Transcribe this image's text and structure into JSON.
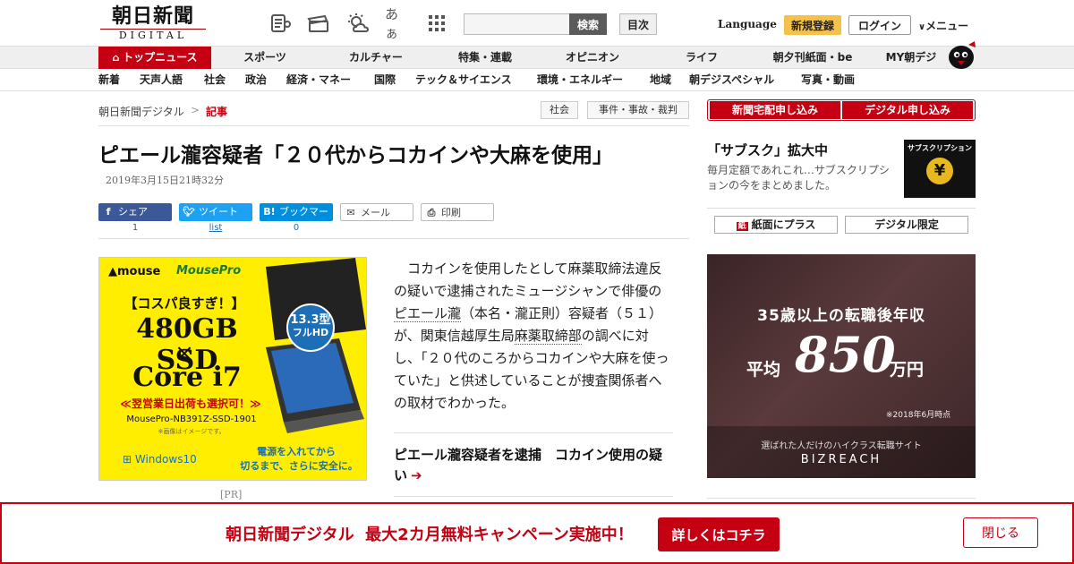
{
  "header": {
    "logo_main": "朝日新聞",
    "logo_sub": "DIGITAL",
    "icons": [
      "newspaper-icon",
      "ticket-icon",
      "weather-icon",
      "font-size-icon",
      "grid-icon"
    ],
    "font_size_glyph": "あぁ",
    "search_placeholder": "",
    "search_label": "検索",
    "index_label": "目次",
    "language_label": "Language",
    "register_label": "新規登録",
    "login_label": "ログイン",
    "menu_label": "メニュー"
  },
  "nav_primary": [
    "トップニュース",
    "スポーツ",
    "カルチャー",
    "特集・連載",
    "オピニオン",
    "ライフ",
    "朝夕刊紙面・be",
    "MY朝デジ"
  ],
  "nav_secondary": [
    "新着",
    "天声人語",
    "社会",
    "政治",
    "経済・マネー",
    "国際",
    "テック＆サイエンス",
    "環境・エネルギー",
    "地域",
    "朝デジスペシャル",
    "写真・動画"
  ],
  "breadcrumb": [
    "朝日新聞デジタル",
    "記事"
  ],
  "breadcrumb_sep": ">",
  "tags": [
    "社会",
    "事件・事故・裁判"
  ],
  "article": {
    "title": "ピエール瀧容疑者「２０代からコカインや大麻を使用」",
    "date": "2019年3月15日21時32分",
    "share": [
      {
        "label": "シェア",
        "count": "1",
        "color": "#3b5998",
        "icon": "f"
      },
      {
        "label": "ツイート",
        "count": "list",
        "color": "#1da1f2",
        "icon": "t"
      },
      {
        "label": "ブックマーク",
        "count": "0",
        "color": "#008fde",
        "icon": "B!"
      },
      {
        "label": "メール",
        "count": "",
        "color": "#ffffff",
        "icon": "✉"
      },
      {
        "label": "印刷",
        "count": "",
        "color": "#ffffff",
        "icon": "⎙"
      }
    ],
    "body_1": "　コカインを使用したとして麻薬取締法違反の疑いで逮捕されたミュージシャンで俳優の",
    "body_link1": "ピエール瀧",
    "body_2": "（本名・瀧正則）容疑者（５１）が、関東信越厚生局",
    "body_link2": "麻薬取締部",
    "body_3": "の調べに対し、「２０代のころからコカインや大麻を使っていた」と供述していることが捜査関係者への取材でわかった。",
    "related_title": "ピエール瀧容疑者を逮捕　コカイン使用の疑い",
    "related_arrow": "➔"
  },
  "ad_left": {
    "brand": "mouse",
    "brand2": "MousePro",
    "tagline": "【コスパ良すぎ！】",
    "spec1": "480GB SSD",
    "times": "×",
    "spec2": "Core i7",
    "tm": "TM",
    "campaign": "≪翌営業日出荷も選択可！≫",
    "model": "MousePro-NB391Z-SSD-1901",
    "note": "※画像はイメージです。",
    "screen_size": "13.3型",
    "screen_res": "フルHD",
    "os": "Windows10",
    "copy1": "電源を入れてから",
    "copy2": "切るまで、さらに安全に。",
    "pr_label": "[PR]"
  },
  "sidebar": {
    "sub_buttons": [
      "新聞宅配申し込み",
      "デジタル申し込み"
    ],
    "promo_title": "「サブスク」拡大中",
    "promo_desc": "毎月定額であれこれ…サブスクリプションの今をまとめました。",
    "promo_img_text": "サブスクリプション",
    "promo_img_symbol": "¥",
    "buttons": [
      "紙面にプラス",
      "デジタル限定"
    ],
    "paper_icon_glyph": "紙"
  },
  "ad_right": {
    "headline": "35歳以上の転職後年収",
    "avg_label": "平均",
    "amount": "850",
    "unit": "万円",
    "note": "※2018年6月時点",
    "footer_copy": "選ばれた人だけのハイクラス転職サイト",
    "brand": "BIZREACH"
  },
  "bottom_bar": {
    "message": "朝日新聞デジタル  最大2カ月無料キャンペーン実施中！",
    "detail_label": "詳しくはコチラ",
    "close_label": "閉じる"
  },
  "colors": {
    "accent": "#c40012",
    "register": "#f4c24a"
  }
}
